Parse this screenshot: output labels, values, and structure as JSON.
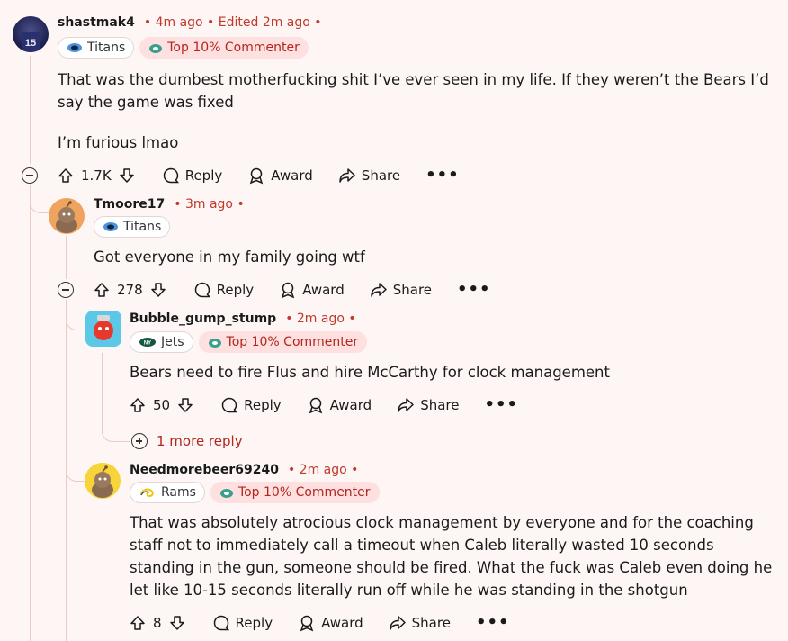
{
  "comments": [
    {
      "username": "shastmak4",
      "meta": "• 4m ago • Edited 2m ago •",
      "flair": "Titans",
      "top_badge": "Top 10% Commenter",
      "body": [
        "That was the dumbest motherfucking shit I’ve ever seen in my life. If they weren’t the Bears I’d say the game was fixed",
        "I’m furious lmao"
      ],
      "votes": "1.7K"
    },
    {
      "username": "Tmoore17",
      "meta": "• 3m ago •",
      "flair": "Titans",
      "body": [
        "Got everyone in my family going wtf"
      ],
      "votes": "278"
    },
    {
      "username": "Bubble_gump_stump",
      "meta": "• 2m ago •",
      "flair": "Jets",
      "top_badge": "Top 10% Commenter",
      "body": [
        "Bears need to fire Flus and hire McCarthy for clock management"
      ],
      "votes": "50",
      "more_replies": "1 more reply"
    },
    {
      "username": "Needmorebeer69240",
      "meta": "• 2m ago •",
      "flair": "Rams",
      "top_badge": "Top 10% Commenter",
      "body": [
        "That was absolutely atrocious clock management by everyone and for the coaching staff not to immediately call a timeout when Caleb literally wasted 10 seconds standing in the gun, someone should be fired. What the fuck was Caleb even doing he let like 10-15 seconds literally run off while he was standing in the shotgun"
      ],
      "votes": "8"
    }
  ],
  "actions": {
    "reply": "Reply",
    "award": "Award",
    "share": "Share",
    "more": "•••"
  },
  "colors": {
    "accent": "#c0392b",
    "thread_line": "#f0c9c4",
    "background": "#fdf6f5"
  },
  "icons": [
    "upvote-icon",
    "downvote-icon",
    "reply-bubble-icon",
    "award-icon",
    "share-icon",
    "collapse-icon",
    "expand-icon",
    "titans-logo-icon",
    "jets-logo-icon",
    "rams-logo-icon",
    "top-commenter-icon"
  ]
}
